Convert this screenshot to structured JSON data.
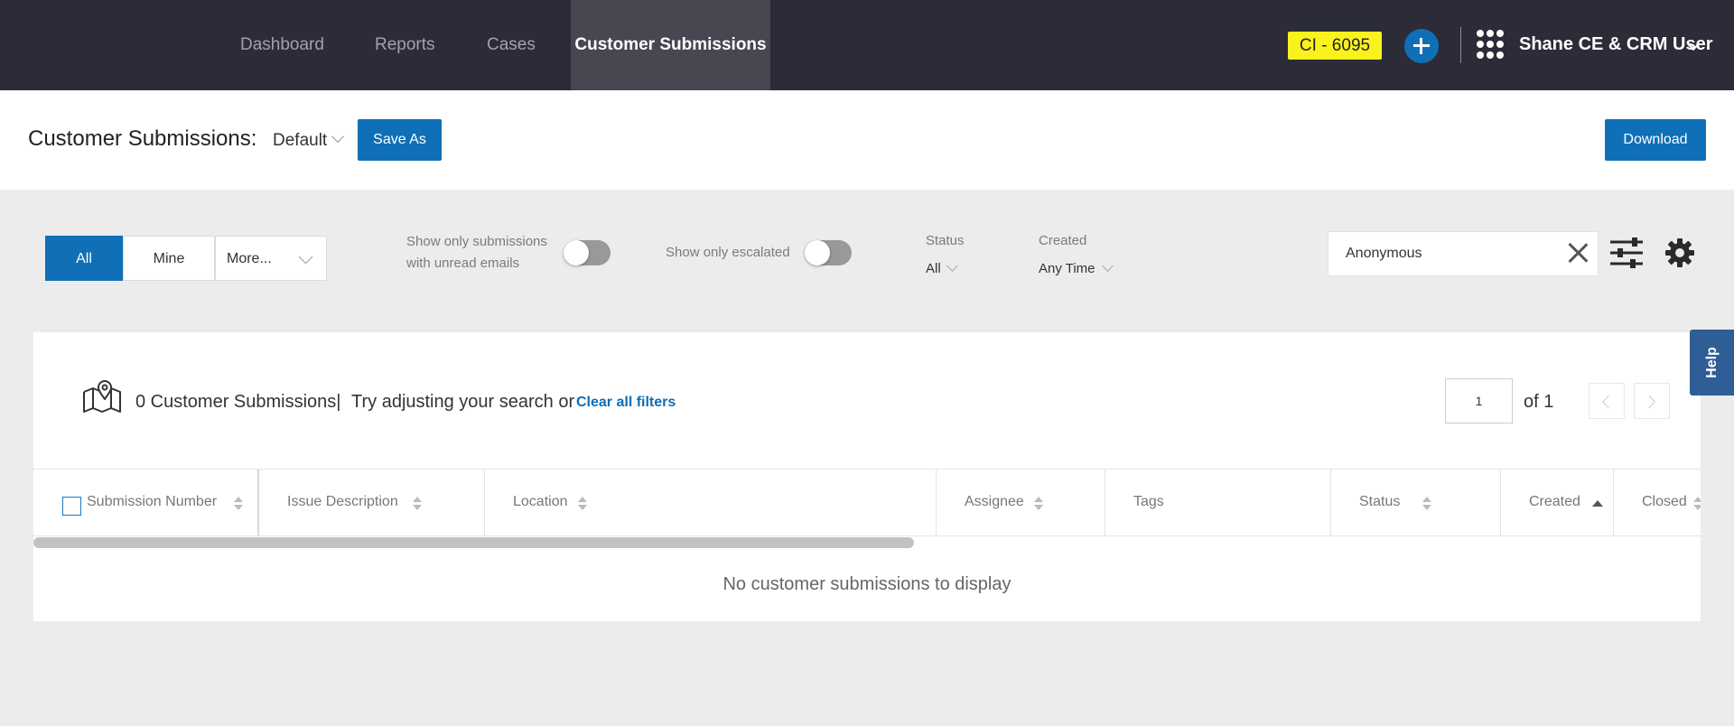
{
  "nav": {
    "items": [
      {
        "label": "Dashboard"
      },
      {
        "label": "Reports"
      },
      {
        "label": "Cases"
      },
      {
        "label": "Customer Submissions"
      }
    ],
    "active": "Customer Submissions",
    "ci_badge": "CI - 6095",
    "user_name": "Shane CE & CRM User",
    "badge_color": "#f9f21c",
    "accent_color": "#0f70b7"
  },
  "header": {
    "title": "Customer Submissions:",
    "view_name": "Default",
    "save_as_label": "Save As",
    "download_label": "Download"
  },
  "filters": {
    "segments": {
      "all": "All",
      "mine": "Mine",
      "more": "More..."
    },
    "unread_label_line1": "Show only submissions",
    "unread_label_line2": "with unread emails",
    "unread_enabled": false,
    "escalated_label": "Show only escalated",
    "escalated_enabled": false,
    "status_label": "Status",
    "status_value": "All",
    "created_label": "Created",
    "created_value": "Any Time",
    "search_value": "Anonymous"
  },
  "results": {
    "count_text": "0 Customer Submissions|",
    "hint": "Try adjusting your search or",
    "clear_link": "Clear all filters",
    "page": "1",
    "of_pages": "of 1"
  },
  "table": {
    "columns": [
      {
        "label": "Submission Number"
      },
      {
        "label": "Issue Description"
      },
      {
        "label": "Location"
      },
      {
        "label": "Assignee"
      },
      {
        "label": "Tags"
      },
      {
        "label": "Status"
      },
      {
        "label": "Created"
      },
      {
        "label": "Closed"
      }
    ],
    "sorted_column": "Created",
    "sort_direction": "ascending",
    "empty_message": "No customer submissions to display"
  },
  "help_label": "Help"
}
